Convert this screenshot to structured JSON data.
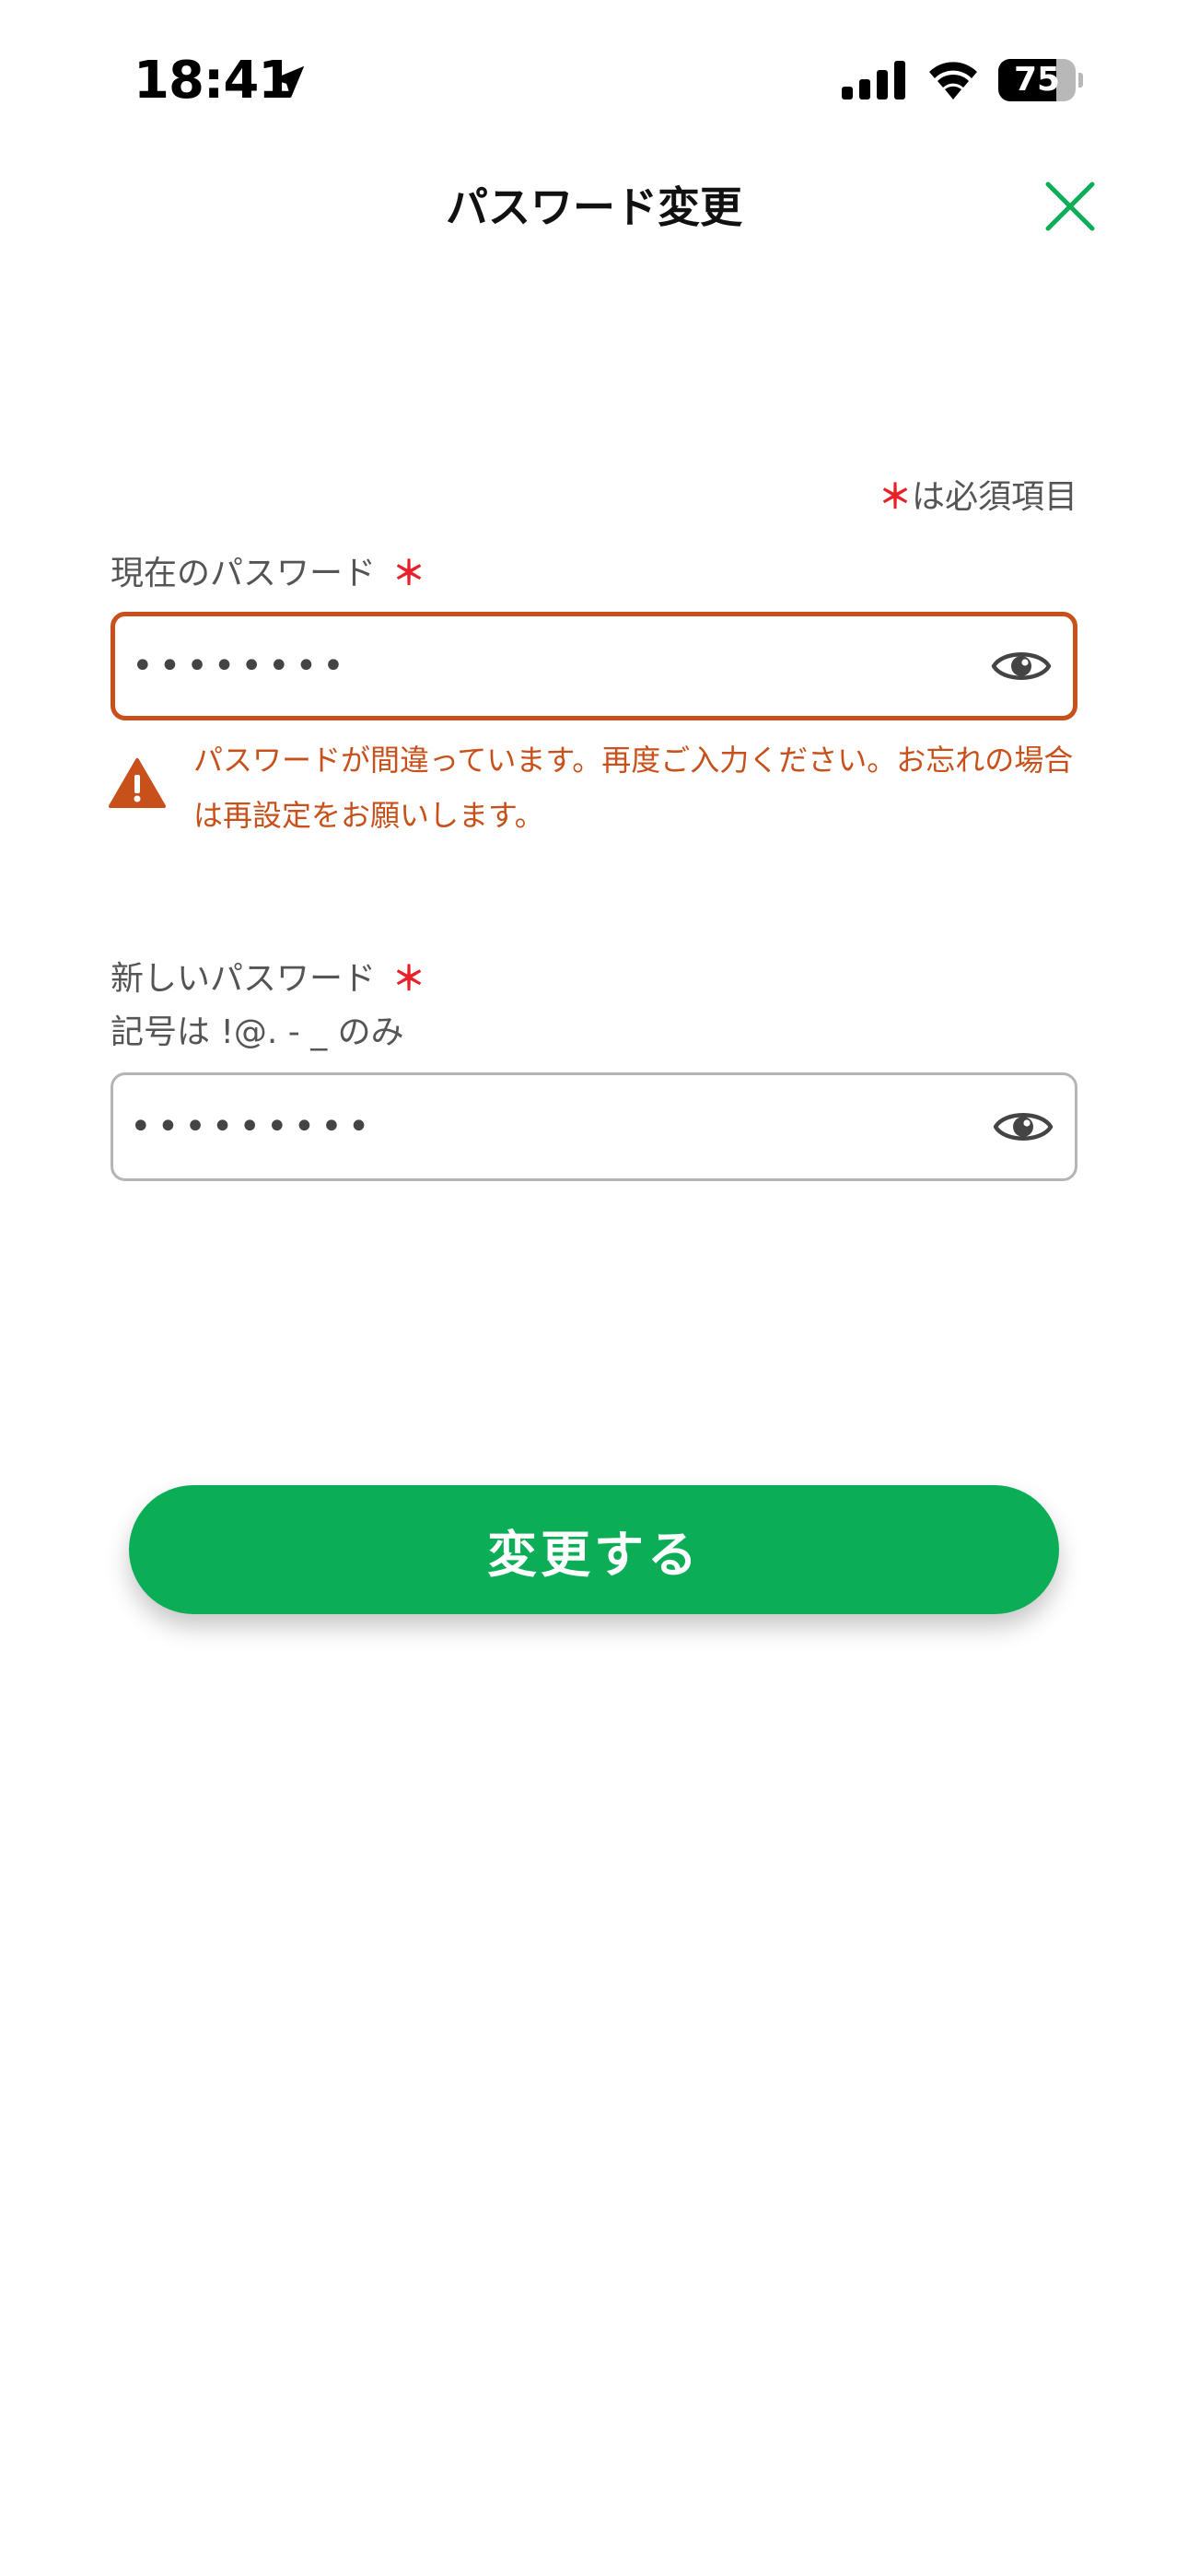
{
  "status_bar": {
    "time": "18:41",
    "battery_level": "75",
    "battery_fraction": 0.75,
    "icons": [
      "location-arrow-icon",
      "cellular-signal-icon",
      "wifi-icon",
      "battery-icon"
    ]
  },
  "header": {
    "title": "パスワード変更",
    "close_icon": "close-icon"
  },
  "form": {
    "required_marker": "＊",
    "required_note": "は必須項目",
    "current_password": {
      "label": "現在のパスワード",
      "value": "12345678",
      "error": "パスワードが間違っています。再度ご入力ください。お忘れの場合は再設定をお願いします。"
    },
    "new_password": {
      "label": "新しいパスワード",
      "hint": "記号は !@. - _ のみ",
      "value": "123456789"
    },
    "submit_label": "変更する"
  },
  "colors": {
    "accent_green": "#0bae57",
    "error_orange": "#c8501a",
    "required_red": "#e8202a",
    "label_gray": "#555555",
    "border_gray": "#b5b5b5"
  }
}
